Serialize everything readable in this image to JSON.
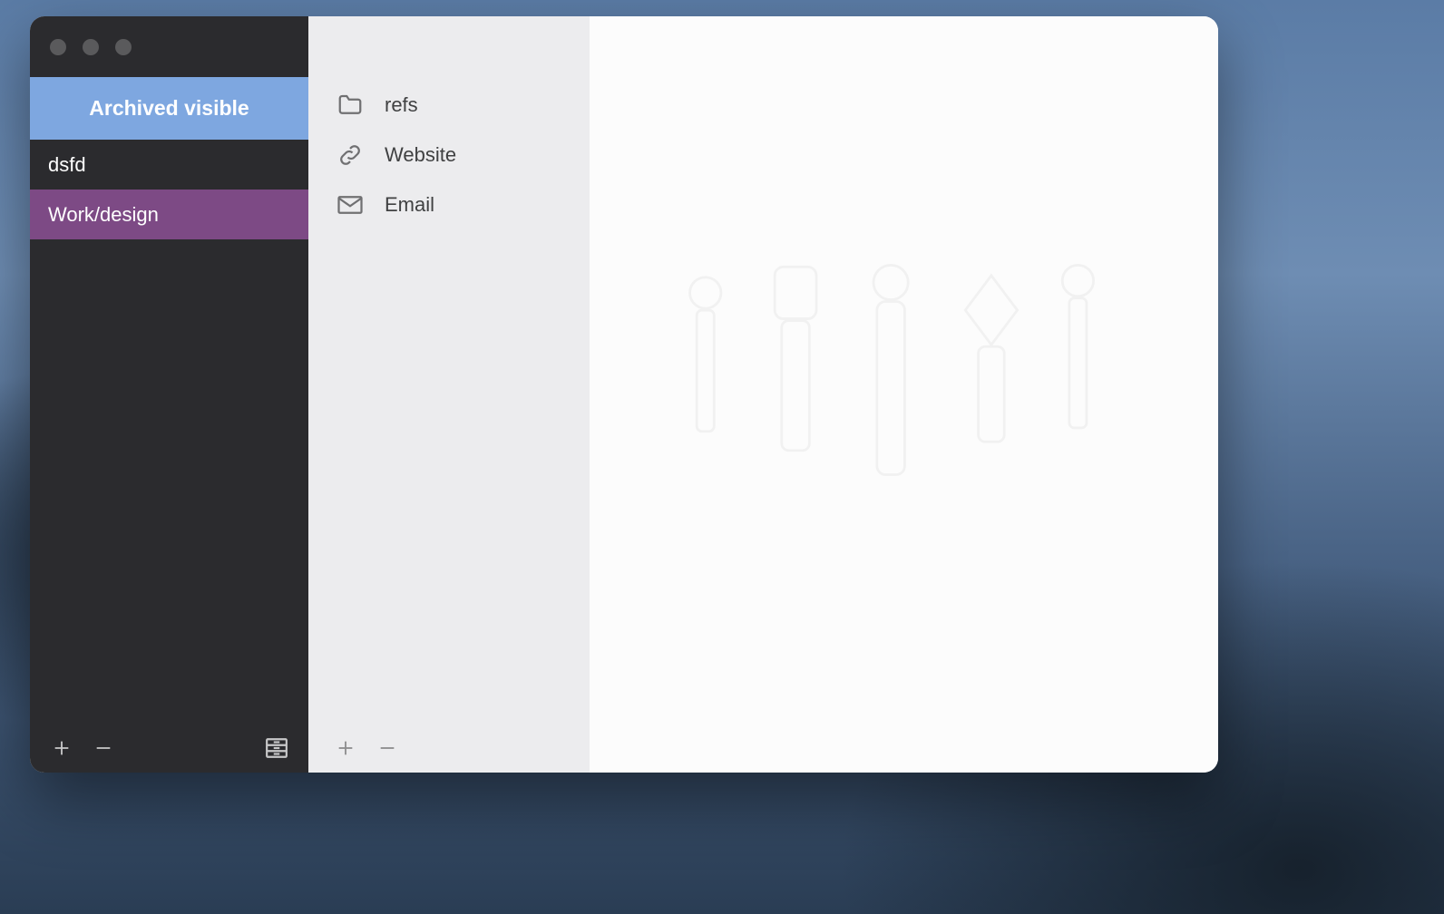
{
  "sidebar": {
    "header_label": "Archived visible",
    "items": [
      {
        "label": "dsfd",
        "selected": false
      },
      {
        "label": "Work/design",
        "selected": true
      }
    ]
  },
  "middle": {
    "items": [
      {
        "icon": "folder",
        "label": "refs"
      },
      {
        "icon": "link",
        "label": "Website"
      },
      {
        "icon": "mail",
        "label": "Email"
      }
    ]
  }
}
